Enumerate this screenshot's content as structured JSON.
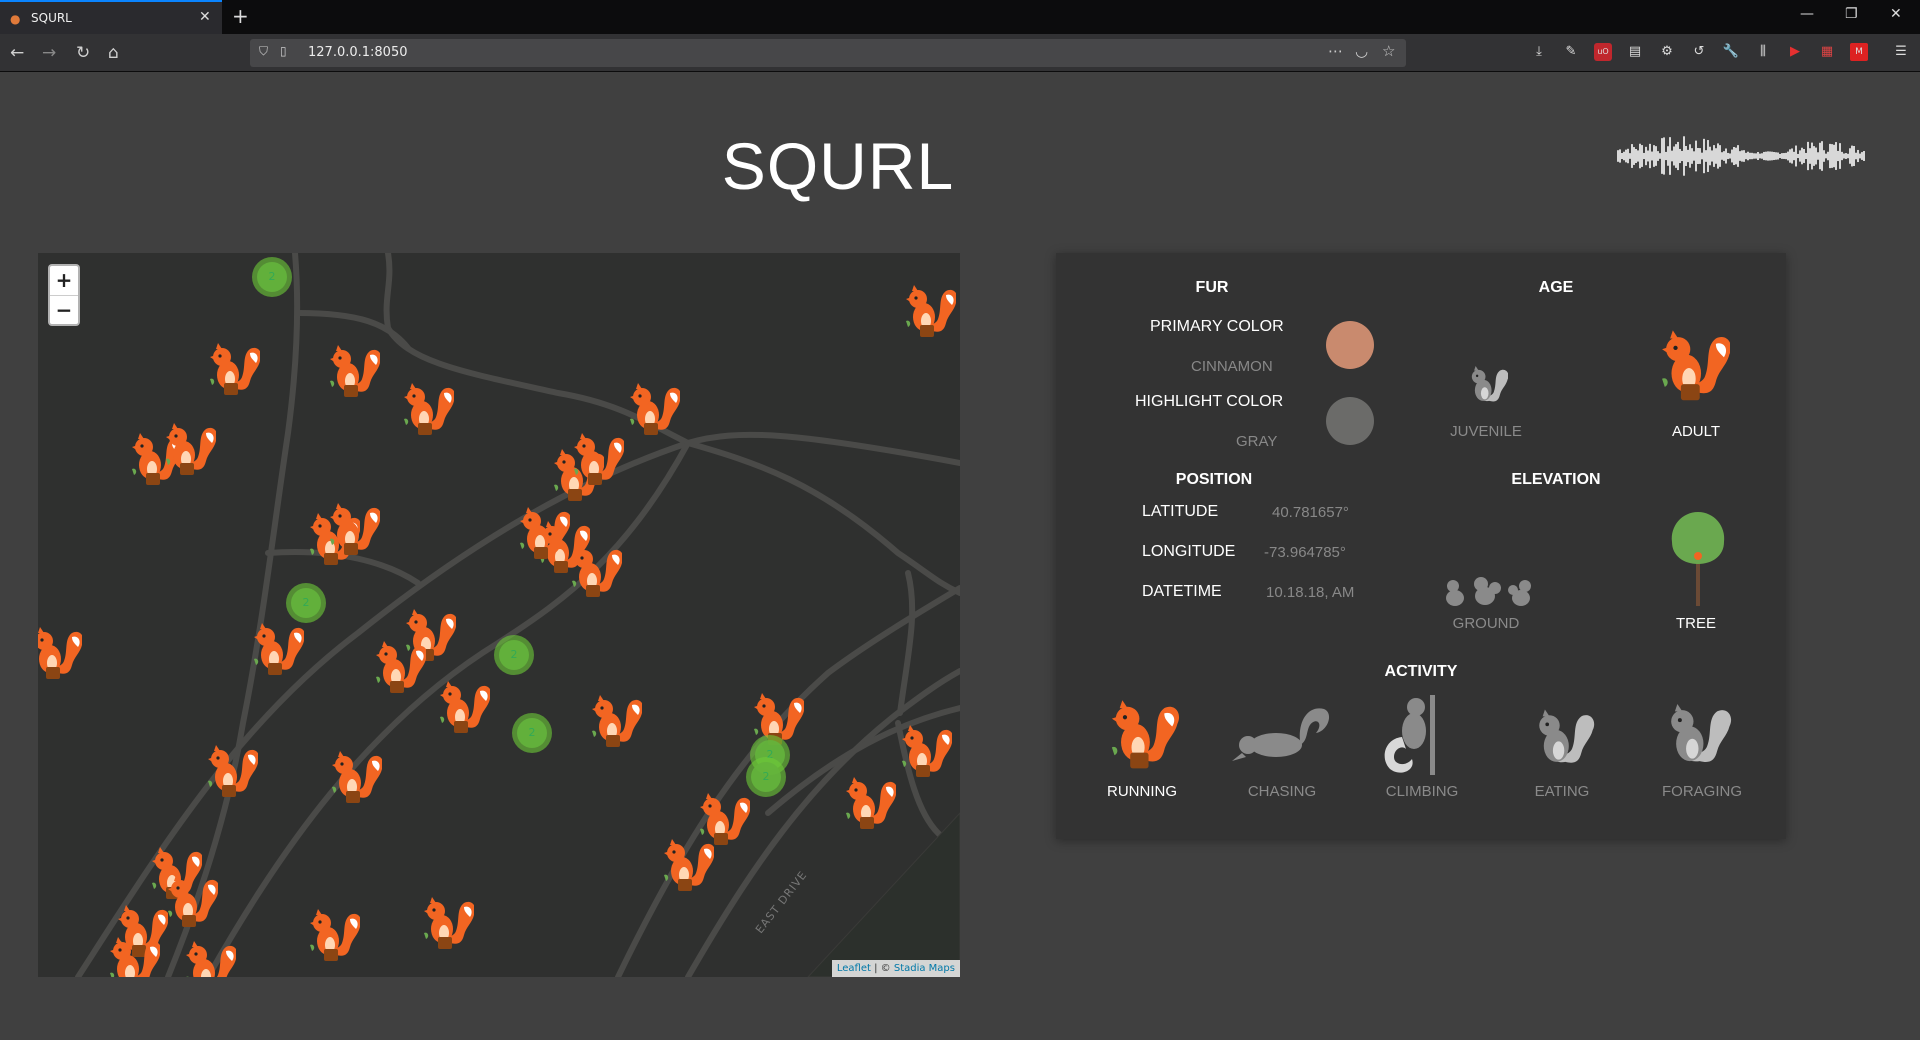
{
  "browser": {
    "tab_title": "SQURL",
    "url": "127.0.0.1:8050",
    "new_tab_symbol": "+",
    "close_symbol": "✕"
  },
  "app": {
    "title": "SQURL"
  },
  "map": {
    "zoom_in": "+",
    "zoom_out": "−",
    "cluster_count": "2",
    "road_label": "EAST DRIVE",
    "attribution_leaflet": "Leaflet",
    "attribution_sep": " | © ",
    "attribution_tiles": "Stadia Maps",
    "accent_color": "#f26522"
  },
  "panel": {
    "fur": {
      "heading": "FUR",
      "primary_label": "PRIMARY COLOR",
      "primary_value": "CINNAMON",
      "primary_swatch": "#c98a6e",
      "highlight_label": "HIGHLIGHT COLOR",
      "highlight_value": "GRAY",
      "highlight_swatch": "#6b6b69"
    },
    "age": {
      "heading": "AGE",
      "options": [
        {
          "label": "JUVENILE",
          "active": false
        },
        {
          "label": "ADULT",
          "active": true
        }
      ]
    },
    "position": {
      "heading": "POSITION",
      "rows": [
        {
          "label": "LATITUDE",
          "value": "40.781657°"
        },
        {
          "label": "LONGITUDE",
          "value": "-73.964785°"
        },
        {
          "label": "DATETIME",
          "value": "10.18.18, AM"
        }
      ]
    },
    "elevation": {
      "heading": "ELEVATION",
      "options": [
        {
          "label": "GROUND",
          "active": false
        },
        {
          "label": "TREE",
          "active": true
        }
      ]
    },
    "activity": {
      "heading": "ACTIVITY",
      "options": [
        {
          "label": "RUNNING",
          "active": true
        },
        {
          "label": "CHASING",
          "active": false
        },
        {
          "label": "CLIMBING",
          "active": false
        },
        {
          "label": "EATING",
          "active": false
        },
        {
          "label": "FORAGING",
          "active": false
        }
      ]
    }
  }
}
